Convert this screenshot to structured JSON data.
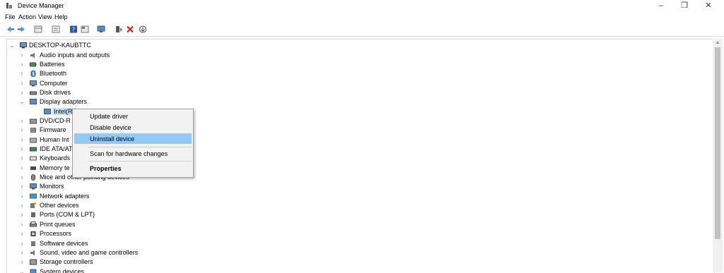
{
  "window": {
    "title": "Device Manager",
    "minimize": "–",
    "restore": "❐",
    "close": "✕"
  },
  "menu": [
    "File",
    "Action",
    "View",
    "Help"
  ],
  "toolbar": {
    "buttons": [
      "back-arrow-icon",
      "forward-arrow-icon",
      "properties-grid-icon",
      "list-icon",
      "help-icon",
      "view-icon",
      "monitor-icon",
      "add-driver-icon",
      "uninstall-x-icon",
      "update-driver-icon"
    ]
  },
  "tree": {
    "root": "DESKTOP-KAUBTTC",
    "categories": [
      {
        "label": "Audio inputs and outputs",
        "icon": "speaker-icon",
        "expanded": false
      },
      {
        "label": "Batteries",
        "icon": "battery-icon",
        "expanded": false
      },
      {
        "label": "Bluetooth",
        "icon": "bluetooth-icon",
        "expanded": false
      },
      {
        "label": "Computer",
        "icon": "computer-icon",
        "expanded": false
      },
      {
        "label": "Disk drives",
        "icon": "disk-drive-icon",
        "expanded": false
      },
      {
        "label": "Display adapters",
        "icon": "display-adapter-icon",
        "expanded": true
      },
      {
        "label": "Intel(R)",
        "icon": "display-adapter-icon",
        "child": true,
        "selected": true
      },
      {
        "label": "DVD/CD-R",
        "icon": "dvd-icon",
        "expanded": false
      },
      {
        "label": "Firmware",
        "icon": "firmware-icon",
        "expanded": false
      },
      {
        "label": "Human Int",
        "icon": "hid-icon",
        "expanded": false
      },
      {
        "label": "IDE ATA/AT",
        "icon": "ide-icon",
        "expanded": false
      },
      {
        "label": "Keyboards",
        "icon": "keyboard-icon",
        "expanded": false
      },
      {
        "label": "Memory te",
        "icon": "memory-icon",
        "expanded": false
      },
      {
        "label": "Mice and other pointing devices",
        "icon": "mouse-icon",
        "expanded": false
      },
      {
        "label": "Monitors",
        "icon": "monitor-icon",
        "expanded": false
      },
      {
        "label": "Network adapters",
        "icon": "network-icon",
        "expanded": false
      },
      {
        "label": "Other devices",
        "icon": "other-device-icon",
        "expanded": false
      },
      {
        "label": "Ports (COM & LPT)",
        "icon": "port-icon",
        "expanded": false
      },
      {
        "label": "Print queues",
        "icon": "printer-icon",
        "expanded": false
      },
      {
        "label": "Processors",
        "icon": "processor-icon",
        "expanded": false
      },
      {
        "label": "Software devices",
        "icon": "software-device-icon",
        "expanded": false
      },
      {
        "label": "Sound, video and game controllers",
        "icon": "sound-icon",
        "expanded": false
      },
      {
        "label": "Storage controllers",
        "icon": "storage-icon",
        "expanded": false
      },
      {
        "label": "System devices",
        "icon": "system-icon",
        "expanded": true
      }
    ]
  },
  "context_menu": {
    "items": [
      {
        "label": "Update driver",
        "highlighted": false
      },
      {
        "label": "Disable device",
        "highlighted": false
      },
      {
        "label": "Uninstall device",
        "highlighted": true
      },
      {
        "label": "Scan for hardware changes",
        "highlighted": false
      },
      {
        "label": "Properties",
        "bold": true,
        "highlighted": false
      }
    ]
  },
  "colors": {
    "selection": "#cce4f7",
    "menu_highlight": "#91c9f7",
    "uninstall_red": "#d21f1f"
  }
}
